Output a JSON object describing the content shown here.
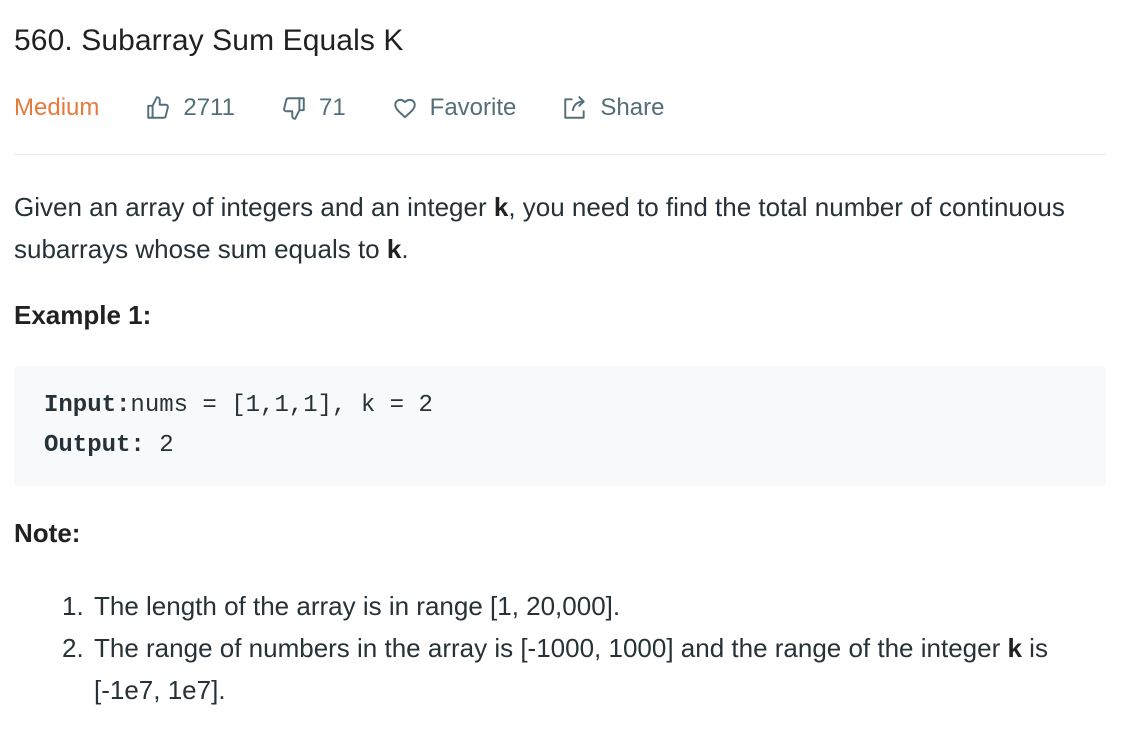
{
  "problem": {
    "title": "560. Subarray Sum Equals K",
    "difficulty": "Medium",
    "likes": "2711",
    "dislikes": "71",
    "favorite_label": "Favorite",
    "share_label": "Share"
  },
  "description": {
    "part1": "Given an array of integers and an integer ",
    "k1": "k",
    "part2": ", you need to find the total number of continuous subarrays whose sum equals to ",
    "k2": "k",
    "part3": "."
  },
  "example": {
    "title": "Example 1:",
    "input_label": "Input:",
    "input_value": "nums = [1,1,1], k = 2",
    "output_label": "Output:",
    "output_value": " 2"
  },
  "note": {
    "title": "Note:",
    "items": [
      {
        "num": "1.",
        "text_a": "The length of the array is in range [1, 20,000].",
        "k": "",
        "text_b": ""
      },
      {
        "num": "2.",
        "text_a": "The range of numbers in the array is [-1000, 1000] and the range of the integer ",
        "k": "k",
        "text_b": " is [-1e7, 1e7]."
      }
    ]
  },
  "colors": {
    "difficulty_medium": "#e67a3a",
    "meta_text": "#546e7a",
    "code_background": "#f7f9fa",
    "divider": "#e6e9eb"
  },
  "icons": {
    "likes": "thumbs-up-icon",
    "dislikes": "thumbs-down-icon",
    "favorite": "heart-icon",
    "share": "share-icon"
  }
}
